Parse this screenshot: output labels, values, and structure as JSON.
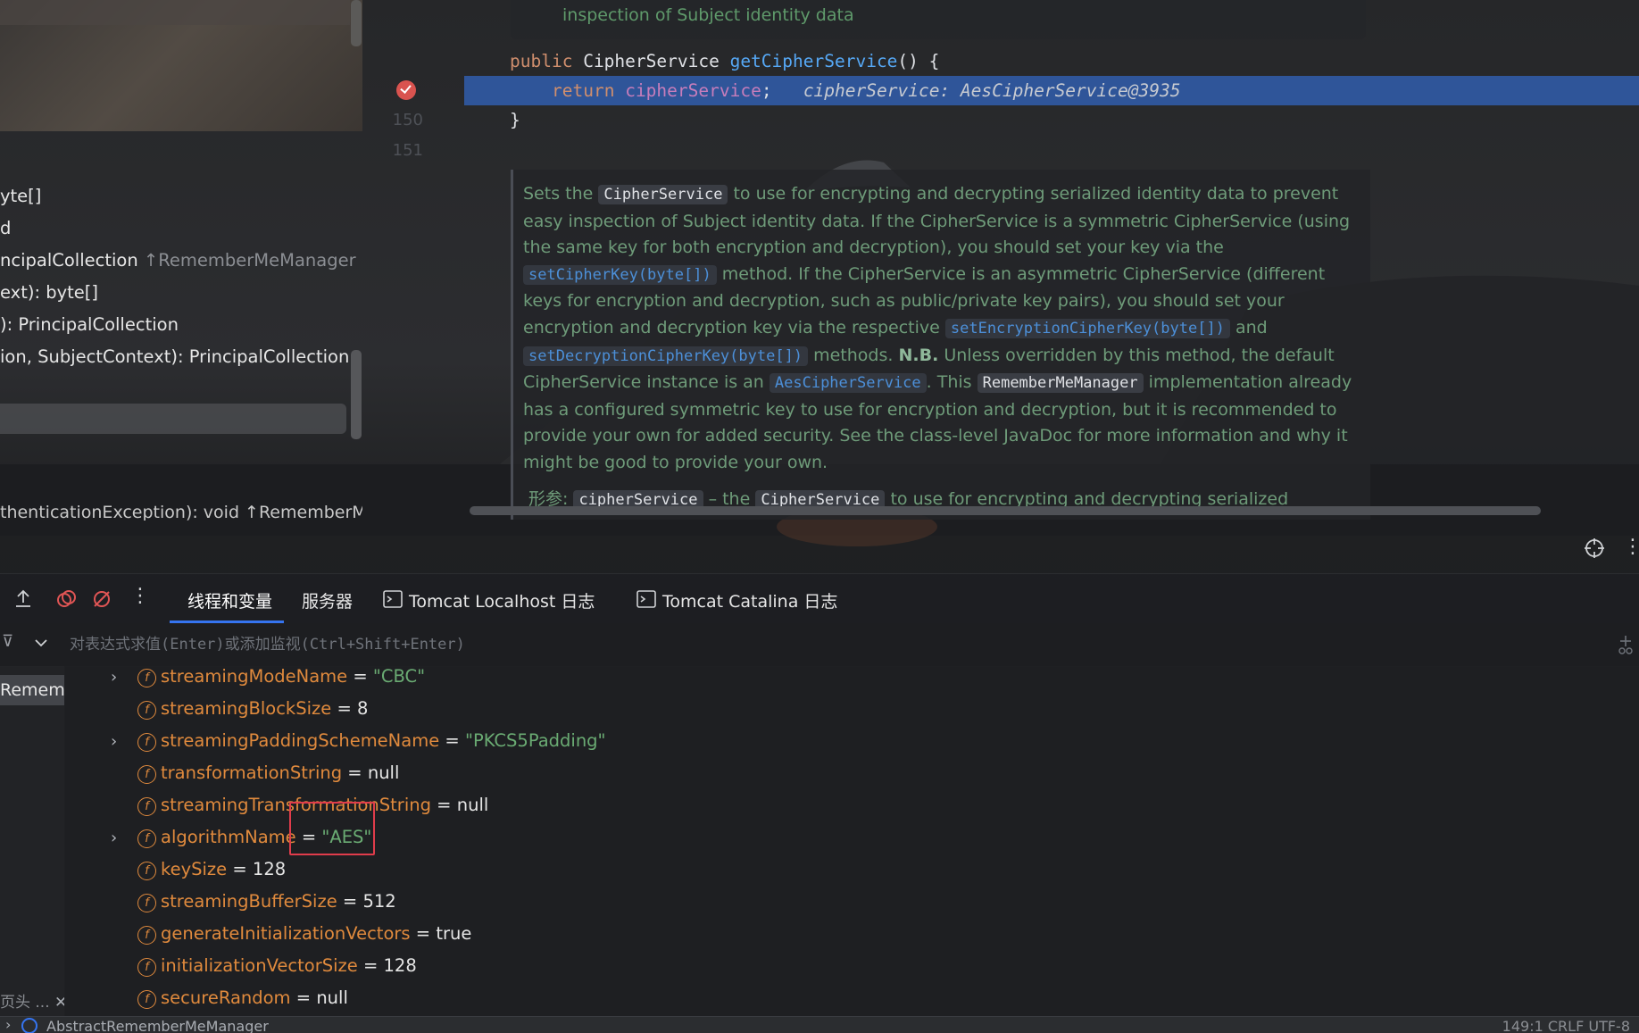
{
  "structure": {
    "items": [
      {
        "text": "yte[]",
        "hint": ""
      },
      {
        "text": "d",
        "hint": ""
      },
      {
        "text": "ncipalCollection",
        "hint": "↑RememberMeManager"
      },
      {
        "text": "ext): byte[]",
        "hint": ""
      },
      {
        "text": "): PrincipalCollection",
        "hint": ""
      },
      {
        "text": "ion, SubjectContext): PrincipalCollection",
        "hint": ""
      }
    ],
    "bottom_text": "thenticationException): void ↑RememberMeManager"
  },
  "editor": {
    "doc_top": "inspection of Subject identity data",
    "line_numbers": [
      "150",
      "151"
    ],
    "code": {
      "kw_public": "public",
      "type": "CipherService",
      "method": "getCipherService",
      "sig_rest": "() {",
      "kw_return": "return",
      "field": "cipherService",
      "semicolon": ";",
      "inline_value": "cipherService: AesCipherService@3935",
      "close_brace": "}"
    },
    "doc": {
      "p1": "Sets the",
      "c1": "CipherService",
      "p2": "to use for encrypting and decrypting serialized identity data to prevent easy inspection of Subject identity data. If the CipherService is a symmetric CipherService (using the same key for both encryption and decryption), you should set your key via the",
      "l1": "setCipherKey(byte[])",
      "p3": "method. If the CipherService is an asymmetric CipherService (different keys for encryption and decryption, such as public/private key pairs), you should set your encryption and decryption key via the respective",
      "l2": "setEncryptionCipherKey(byte[])",
      "p4": "and",
      "l3": "setDecryptionCipherKey(byte[])",
      "p5": "methods.",
      "nb": "N.B.",
      "p6": "Unless overridden by this method, the default CipherService instance is an",
      "l4": "AesCipherService",
      "p7": ". This",
      "c2": "RememberMeManager",
      "p8": "implementation already has a configured symmetric key to use for encryption and decryption, but it is recommended to provide your own for added security. See the class-level JavaDoc for more information and why it might be good to provide your own.",
      "param_label": "形参:",
      "param_name": "cipherService",
      "param_dash": "– the",
      "param_type": "CipherService",
      "param_rest": "to use for encrypting and decrypting serialized"
    }
  },
  "debug": {
    "tabs": [
      "线程和变量",
      "服务器",
      "Tomcat Localhost 日志",
      "Tomcat Catalina 日志"
    ],
    "eval_placeholder": "对表达式求值(Enter)或添加监视(Ctrl+Shift+Enter)",
    "frame_label": "Rememb",
    "frames_bottom": "页头 ...",
    "variables": [
      {
        "name": "streamingModeName",
        "eq": " = ",
        "value": "\"CBC\"",
        "kind": "string",
        "expandable": true
      },
      {
        "name": "streamingBlockSize",
        "eq": " = ",
        "value": "8",
        "kind": "plain",
        "expandable": false
      },
      {
        "name": "streamingPaddingSchemeName",
        "eq": " = ",
        "value": "\"PKCS5Padding\"",
        "kind": "string",
        "expandable": true
      },
      {
        "name": "transformationString",
        "eq": " = ",
        "value": "null",
        "kind": "plain",
        "expandable": false
      },
      {
        "name": "streamingTransformationString",
        "eq": " = ",
        "value": "null",
        "kind": "plain",
        "expandable": false
      },
      {
        "name": "algorithmName",
        "eq": " = ",
        "value": "\"AES\"",
        "kind": "string",
        "expandable": true
      },
      {
        "name": "keySize",
        "eq": " = ",
        "value": "128",
        "kind": "plain",
        "expandable": false
      },
      {
        "name": "streamingBufferSize",
        "eq": " = ",
        "value": "512",
        "kind": "plain",
        "expandable": false
      },
      {
        "name": "generateInitializationVectors",
        "eq": " = ",
        "value": "true",
        "kind": "plain",
        "expandable": false
      },
      {
        "name": "initializationVectorSize",
        "eq": " = ",
        "value": "128",
        "kind": "plain",
        "expandable": false
      },
      {
        "name": "secureRandom",
        "eq": " = ",
        "value": "null",
        "kind": "plain",
        "expandable": false
      }
    ]
  },
  "statusbar": {
    "breadcrumb": "AbstractRememberMeManager",
    "right": "149:1   CRLF   UTF-8"
  },
  "colors": {
    "accent": "#3574f0",
    "exec_line": "#2f5599",
    "highlight": "#e03c4b",
    "field_icon": "#e08a3d"
  }
}
